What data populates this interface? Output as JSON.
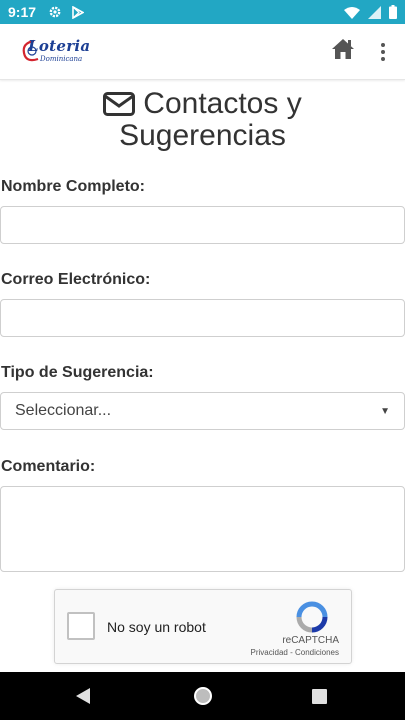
{
  "status_bar": {
    "time": "9:17",
    "icons_left": [
      "gear-icon",
      "play-store-icon"
    ],
    "icons_right": [
      "wifi-icon",
      "signal-icon",
      "battery-icon"
    ]
  },
  "app_bar": {
    "logo_main": "Loteria",
    "logo_sub": "Dominicana",
    "home_icon": "home-icon",
    "menu_icon": "overflow-menu-icon"
  },
  "page": {
    "title_line1": "Contactos y",
    "title_line2": "Sugerencias",
    "title_icon": "envelope-icon"
  },
  "form": {
    "name_label": "Nombre Completo:",
    "name_value": "",
    "email_label": "Correo Electrónico:",
    "email_value": "",
    "type_label": "Tipo de Sugerencia:",
    "type_selected": "Seleccionar...",
    "comment_label": "Comentario:",
    "comment_value": ""
  },
  "recaptcha": {
    "checkbox_label": "No soy un robot",
    "brand": "reCAPTCHA",
    "links": "Privacidad - Condiciones"
  },
  "nav_bar": {
    "back_icon": "back-triangle-icon",
    "home_icon": "home-circle-icon",
    "recents_icon": "recents-square-icon"
  },
  "colors": {
    "status_bar": "#22a7c4",
    "logo_blue": "#1c3f94",
    "logo_red": "#d3252f",
    "text": "#333333"
  }
}
